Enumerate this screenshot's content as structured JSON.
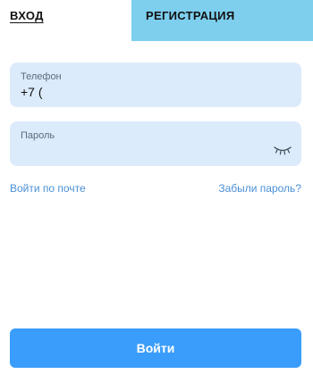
{
  "tabs": {
    "login_label": "ВХОД",
    "register_label": "РЕГИСТРАЦИЯ"
  },
  "form": {
    "phone_label": "Телефон",
    "phone_value": "+7 (",
    "password_label": "Пароль",
    "password_icon": "eye-closed-icon"
  },
  "links": {
    "email_login": "Войти по почте",
    "forgot_password": "Забыли пароль?"
  },
  "submit_label": "Войти",
  "colors": {
    "register_tab_bg": "#7ecfee",
    "field_bg": "#dcebfb",
    "link": "#4a8fd6",
    "primary_button": "#3a9dfb"
  }
}
